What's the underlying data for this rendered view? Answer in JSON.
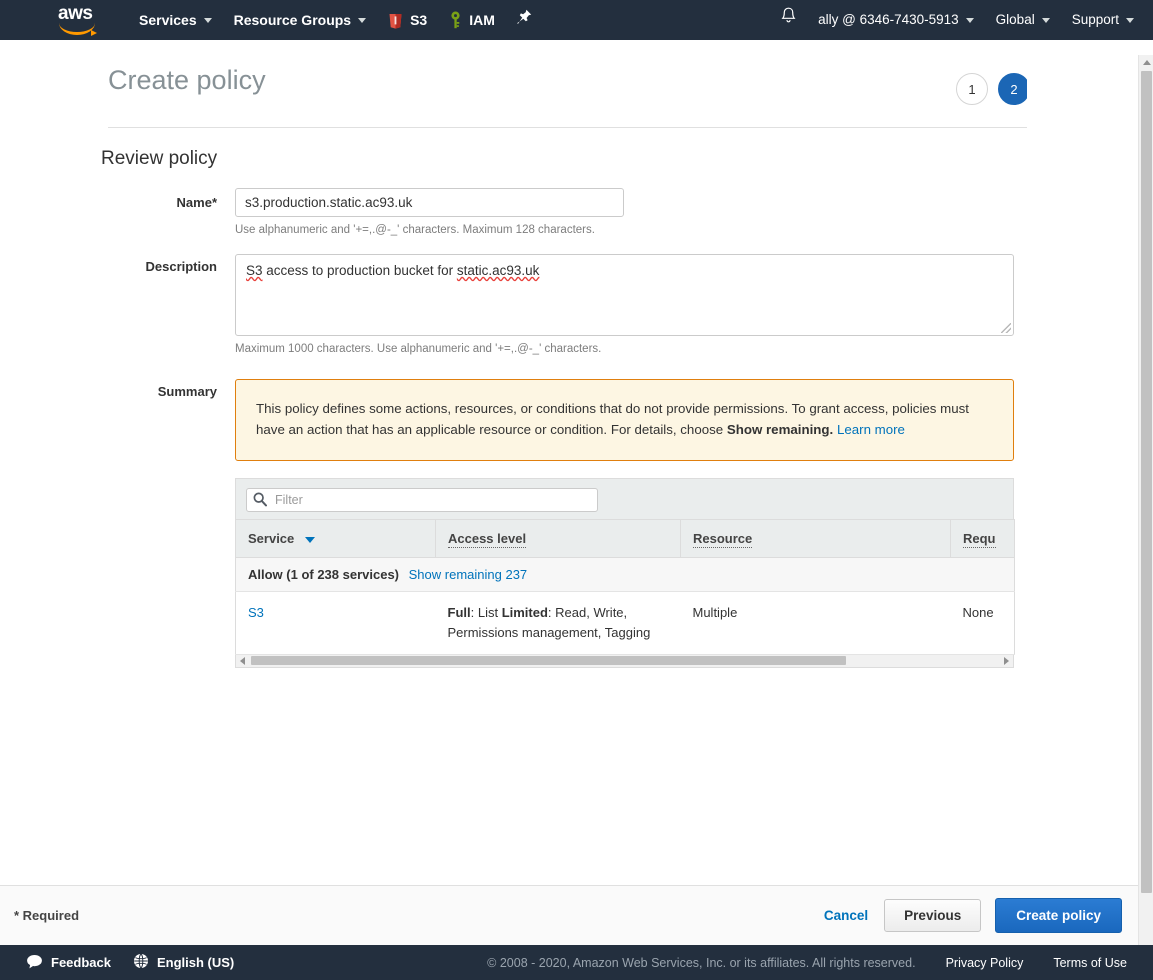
{
  "nav": {
    "logo_word": "aws",
    "services": "Services",
    "resource_groups": "Resource Groups",
    "shortcut_s3": "S3",
    "shortcut_iam": "IAM",
    "pin_icon": "pin-icon",
    "bell_icon": "notifications-bell-icon",
    "account": "ally @ 6346-7430-5913",
    "region": "Global",
    "support": "Support"
  },
  "header": {
    "title": "Create policy",
    "steps": [
      {
        "label": "1",
        "state": "inactive"
      },
      {
        "label": "2",
        "state": "active"
      }
    ]
  },
  "review": {
    "section_title": "Review policy",
    "name": {
      "label": "Name*",
      "value": "s3.production.static.ac93.uk",
      "placeholder": "",
      "hint": "Use alphanumeric and '+=,.@-_' characters. Maximum 128 characters."
    },
    "description": {
      "label": "Description",
      "value_parts": [
        {
          "text": "S3",
          "misspelled": true
        },
        {
          "text": " access to production bucket for ",
          "misspelled": false
        },
        {
          "text": "static.ac93.uk",
          "misspelled": true
        }
      ],
      "hint": "Maximum 1000 characters. Use alphanumeric and '+=,.@-_' characters."
    },
    "summary": {
      "label": "Summary",
      "text_1": "This policy defines some actions, resources, or conditions that do not provide permissions. To grant access, policies must have an action that has an applicable resource or condition. For details, choose ",
      "bold": "Show remaining.",
      "text_2": " ",
      "learn_more": "Learn more"
    }
  },
  "table": {
    "filter_placeholder": "Filter",
    "search_icon": "search-icon",
    "columns": [
      {
        "label": "Service",
        "sortable": true,
        "tooltip": false
      },
      {
        "label": "Access level",
        "sortable": false,
        "tooltip": true
      },
      {
        "label": "Resource",
        "sortable": false,
        "tooltip": true
      },
      {
        "label": "Requ",
        "sortable": false,
        "tooltip": true
      }
    ],
    "group": {
      "label": "Allow (1 of 238 services)",
      "show_remaining": "Show remaining 237"
    },
    "rows": [
      {
        "service": "S3",
        "access_full_label": "Full",
        "access_full_value": ": List ",
        "access_limited_label": "Limited",
        "access_limited_value": ": Read, Write, Permissions management, Tagging",
        "resource": "Multiple",
        "request_condition": "None"
      }
    ]
  },
  "actions": {
    "required_note": "* Required",
    "cancel": "Cancel",
    "previous": "Previous",
    "create": "Create policy"
  },
  "footer": {
    "feedback": "Feedback",
    "feedback_icon": "speech-bubble-icon",
    "language": "English (US)",
    "language_icon": "globe-icon",
    "copyright": "© 2008 - 2020, Amazon Web Services, Inc. or its affiliates. All rights reserved.",
    "privacy": "Privacy Policy",
    "terms": "Terms of Use"
  },
  "colors": {
    "nav_bg": "#232f3e",
    "accent_blue": "#1b66b5",
    "link_blue": "#0073bb",
    "warning_border": "#e07f0e",
    "warning_bg": "#fdf6e3",
    "aws_orange": "#ff9900"
  }
}
